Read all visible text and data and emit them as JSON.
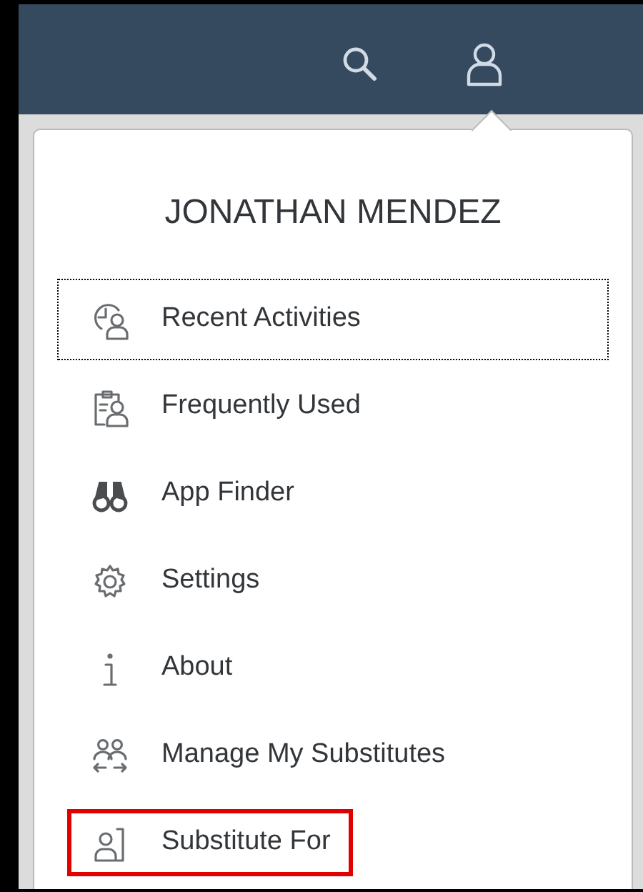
{
  "user_menu": {
    "name": "JONATHAN MENDEZ",
    "items": [
      {
        "label": "Recent Activities",
        "focused": true,
        "highlighted": false
      },
      {
        "label": "Frequently Used",
        "focused": false,
        "highlighted": false
      },
      {
        "label": "App Finder",
        "focused": false,
        "highlighted": false
      },
      {
        "label": "Settings",
        "focused": false,
        "highlighted": false
      },
      {
        "label": "About",
        "focused": false,
        "highlighted": false
      },
      {
        "label": "Manage My Substitutes",
        "focused": false,
        "highlighted": false
      },
      {
        "label": "Substitute For",
        "focused": false,
        "highlighted": true
      }
    ]
  }
}
